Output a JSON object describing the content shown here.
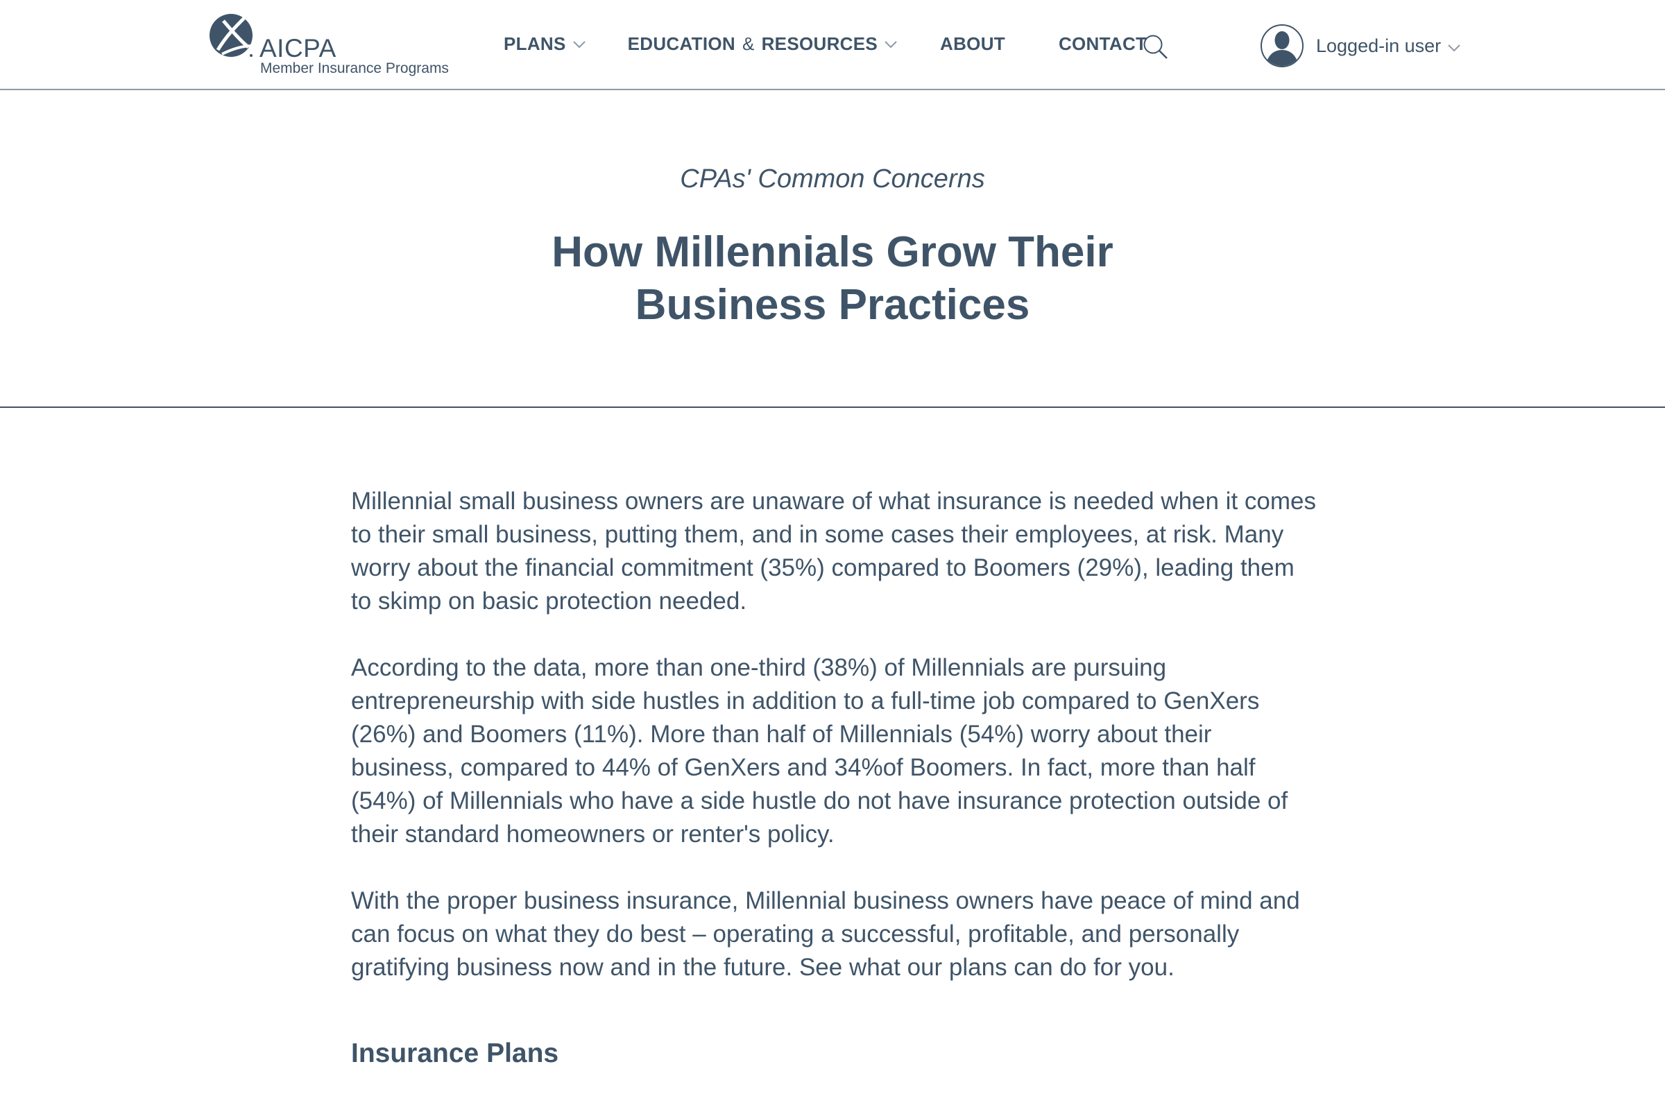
{
  "header": {
    "logo": {
      "wordmark": "AICPA",
      "subtitle": "Member Insurance Programs"
    },
    "nav": {
      "plans": "PLANS",
      "education_part1": "EDUCATION",
      "education_amp": "&",
      "education_part2": "RESOURCES",
      "about": "ABOUT",
      "contact": "CONTACT"
    },
    "search_icon": "search-icon",
    "user": {
      "label": "Logged-in user",
      "avatar_icon": "user-avatar-icon"
    }
  },
  "hero": {
    "kicker": "CPAs' Common Concerns",
    "title_line1": "How Millennials Grow Their",
    "title_line2": "Business Practices"
  },
  "article": {
    "paragraphs": [
      "Millennial small business owners are unaware of what insurance is needed when it comes to their small business, putting them, and in some cases their employees, at risk. Many worry about the financial commitment (35%) compared to Boomers (29%), leading them to skimp on basic protection needed.",
      "According to the data, more than one-third (38%) of Millennials are pursuing entrepreneurship with side hustles in addition to a full-time job compared to GenXers (26%) and Boomers (11%). More than half of Millennials (54%) worry about their business, compared to 44% of GenXers and 34%of Boomers. In fact, more than half (54%) of Millennials who have a side hustle do not have insurance protection outside of their standard homeowners or renter's policy.",
      "With the proper business insurance, Millennial business owners have peace of mind and can focus on what they do best – operating a successful, profitable, and personally gratifying business now and in the future. See what our plans can do for you."
    ],
    "section_heading": "Insurance Plans"
  },
  "colors": {
    "primary_text": "#3f5468",
    "divider": "#8d9aa6",
    "background": "#ffffff"
  }
}
